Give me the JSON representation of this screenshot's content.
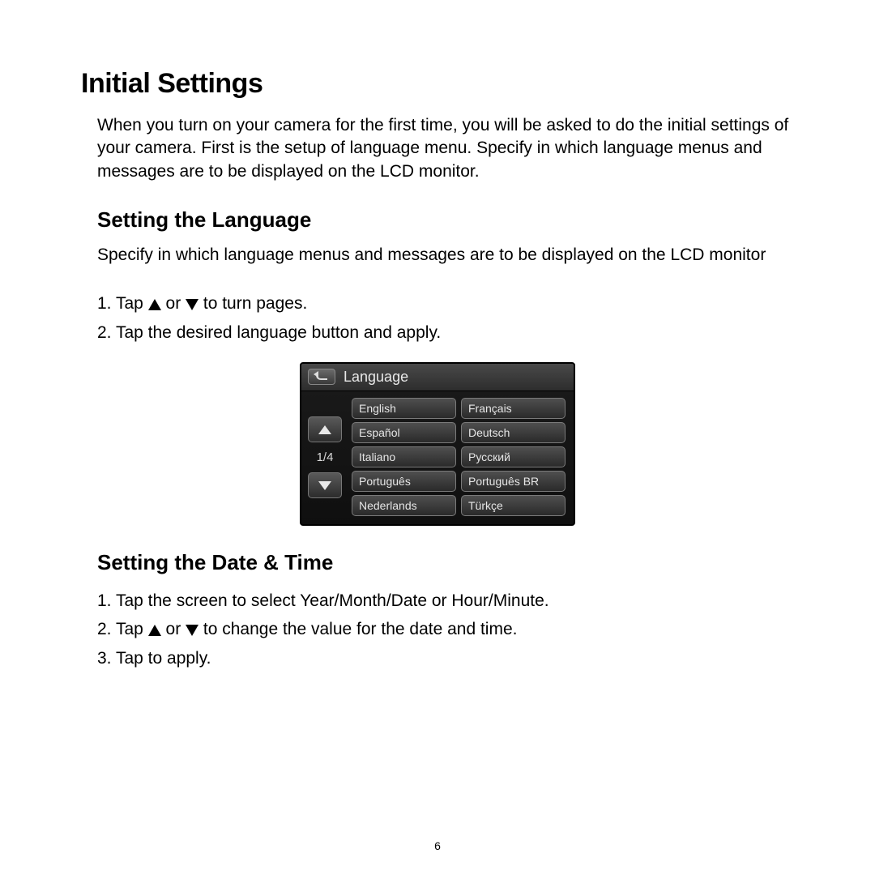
{
  "page_number": "6",
  "h1": "Initial Settings",
  "intro": "When you turn on your camera for the first time, you will be asked to do the initial settings of your camera. First is the setup of language menu. Specify in which language menus and messages are to be displayed on the LCD monitor.",
  "section1": {
    "heading": "Setting the Language",
    "desc": "Specify in which language menus and messages are to be displayed on the LCD monitor",
    "step1_a": "1.  Tap ",
    "step1_b": " or ",
    "step1_c": " to turn pages.",
    "step2": "2.  Tap the desired language button and apply."
  },
  "lcd": {
    "title": "Language",
    "pager": "1/4",
    "languages": [
      "English",
      "Français",
      "Español",
      "Deutsch",
      "Italiano",
      "Русский",
      "Português",
      "Português BR",
      "Nederlands",
      "Türkçe"
    ]
  },
  "section2": {
    "heading": "Setting the Date & Time",
    "step1": "1.  Tap the screen to select Year/Month/Date or Hour/Minute.",
    "step2_a": "2.  Tap ",
    "step2_b": " or ",
    "step2_c": " to change the value for the date and time.",
    "step3": "3.  Tap to apply."
  }
}
